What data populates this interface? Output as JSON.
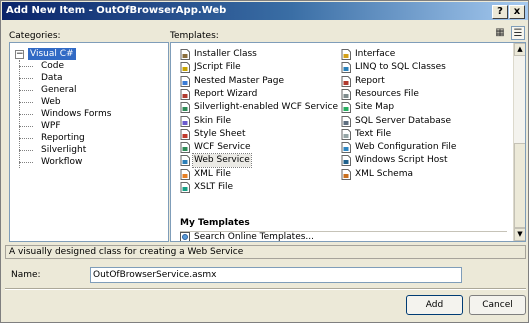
{
  "window": {
    "title": "Add New Item - OutOfBrowserApp.Web",
    "help_glyph": "?",
    "close_glyph": "x"
  },
  "categories": {
    "label": "Categories:",
    "root": {
      "label": "Visual C#",
      "expander": "−"
    },
    "items": [
      "Code",
      "Data",
      "General",
      "Web",
      "Windows Forms",
      "WPF",
      "Reporting",
      "Silverlight",
      "Workflow"
    ]
  },
  "templates": {
    "label": "Templates:",
    "view_buttons": {
      "large_icons": "large-icons-view-icon",
      "small_icons": "small-icons-view-icon"
    },
    "left_column": [
      {
        "label": "Installer Class",
        "icon": "installer-icon"
      },
      {
        "label": "JScript File",
        "icon": "jscript-icon"
      },
      {
        "label": "Nested Master Page",
        "icon": "master-page-icon"
      },
      {
        "label": "Report Wizard",
        "icon": "report-wizard-icon"
      },
      {
        "label": "Silverlight-enabled WCF Service",
        "icon": "wcf-service-icon"
      },
      {
        "label": "Skin File",
        "icon": "skin-file-icon"
      },
      {
        "label": "Style Sheet",
        "icon": "style-sheet-icon"
      },
      {
        "label": "WCF Service",
        "icon": "wcf-service-icon"
      },
      {
        "label": "Web Service",
        "icon": "web-service-icon",
        "selected": true
      },
      {
        "label": "XML File",
        "icon": "xml-file-icon"
      },
      {
        "label": "XSLT File",
        "icon": "xslt-file-icon"
      }
    ],
    "right_column": [
      {
        "label": "Interface",
        "icon": "interface-icon"
      },
      {
        "label": "LINQ to SQL Classes",
        "icon": "linq-icon"
      },
      {
        "label": "Report",
        "icon": "report-icon"
      },
      {
        "label": "Resources File",
        "icon": "resources-icon"
      },
      {
        "label": "Site Map",
        "icon": "site-map-icon"
      },
      {
        "label": "SQL Server Database",
        "icon": "database-icon"
      },
      {
        "label": "Text File",
        "icon": "text-file-icon"
      },
      {
        "label": "Web Configuration File",
        "icon": "web-config-icon"
      },
      {
        "label": "Windows Script Host",
        "icon": "script-host-icon"
      },
      {
        "label": "XML Schema",
        "icon": "xml-schema-icon"
      }
    ],
    "my_templates_heading": "My Templates",
    "search_online": {
      "label": "Search Online Templates...",
      "icon": "search-online-icon"
    },
    "scroll_up": "▲",
    "scroll_down": "▼"
  },
  "description": "A visually designed class for creating a Web Service",
  "name_field": {
    "label": "Name:",
    "value": "OutOfBrowserService.asmx"
  },
  "buttons": {
    "add": "Add",
    "cancel": "Cancel"
  },
  "colors": {
    "title_start": "#0a246a",
    "title_end": "#a6caf0",
    "selection": "#316ac5",
    "dialog_bg": "#ece9d8"
  }
}
